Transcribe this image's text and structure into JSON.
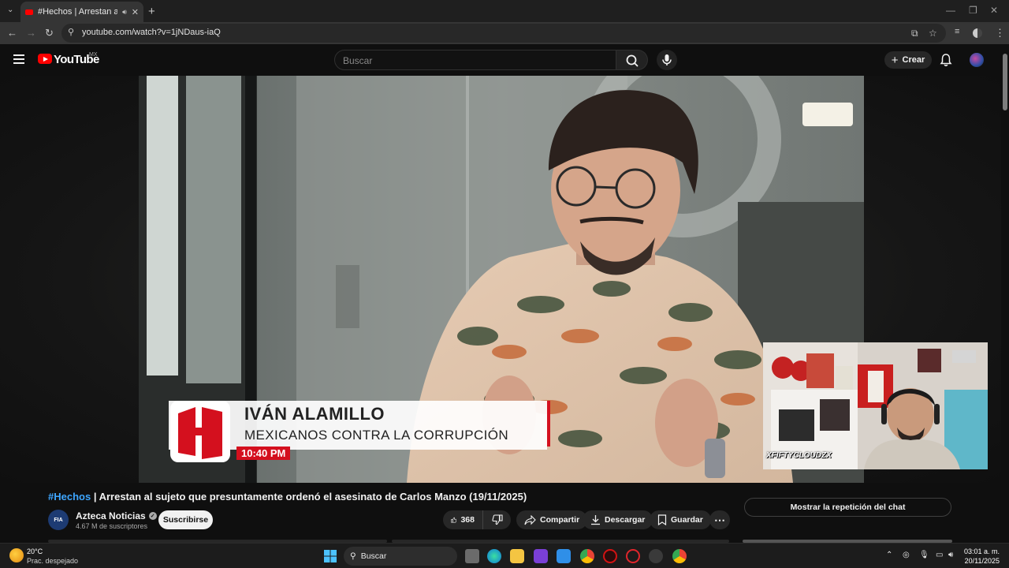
{
  "browser": {
    "tab_title": "#Hechos | Arrestan al sujeto",
    "url": "youtube.com/watch?v=1jNDaus-iaQ"
  },
  "youtube": {
    "logo_text": "YouTube",
    "country": "MX",
    "search_placeholder": "Buscar",
    "create_label": "Crear"
  },
  "video": {
    "lower_third_name": "IVÁN ALAMILLO",
    "lower_third_subtitle": "MEXICANOS CONTRA LA CORRUPCIÓN",
    "lower_third_time": "10:40 PM",
    "webcam_tag": "XFIFTYCLOUDZX",
    "title_hashtag": "#Hechos",
    "title_text": "| Arrestan al sujeto que presuntamente ordenó el asesinato de Carlos Manzo (19/11/2025)"
  },
  "channel": {
    "avatar_text": "FIA",
    "name": "Azteca Noticias",
    "subscribers": "4.67 M de suscriptores",
    "subscribe_label": "Suscribirse"
  },
  "actions": {
    "likes": "368",
    "share": "Compartir",
    "download": "Descargar",
    "save": "Guardar"
  },
  "chat": {
    "replay_label": "Mostrar la repetición del chat"
  },
  "taskbar": {
    "temperature": "20°C",
    "condition": "Prac. despejado",
    "search_label": "Buscar",
    "time": "03:01 a. m.",
    "date": "20/11/2025"
  },
  "colors": {
    "youtube_red": "#ff0000",
    "link_blue": "#3ea6ff",
    "news_red": "#d4101e"
  }
}
